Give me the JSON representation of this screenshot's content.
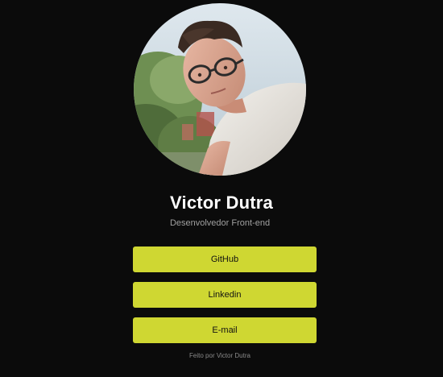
{
  "profile": {
    "name": "Victor Dutra",
    "role": "Desenvolvedor Front-end"
  },
  "links": [
    {
      "label": "GitHub"
    },
    {
      "label": "Linkedin"
    },
    {
      "label": "E-mail"
    }
  ],
  "footer": {
    "text": "Feito por Victor Dutra"
  },
  "colors": {
    "background": "#0b0b0b",
    "button": "#cfd732",
    "button_text": "#111111",
    "name": "#ffffff",
    "role": "#a0a0a0"
  }
}
